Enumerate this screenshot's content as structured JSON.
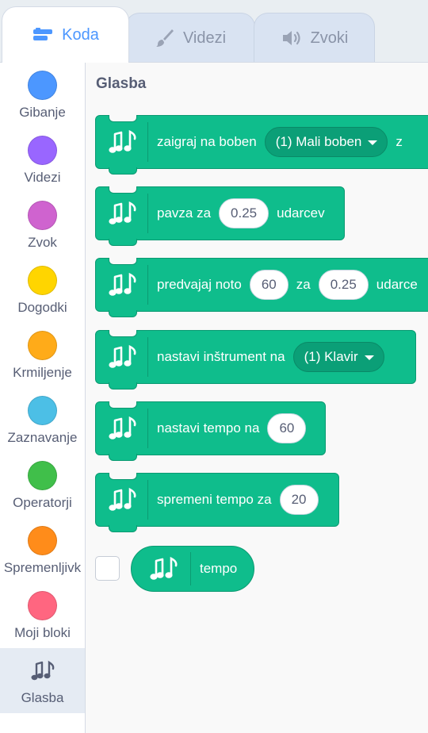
{
  "tabs": [
    {
      "label": "Koda",
      "icon": "code-icon",
      "active": true
    },
    {
      "label": "Videzi",
      "icon": "paintbrush-icon",
      "active": false
    },
    {
      "label": "Zvoki",
      "icon": "speaker-icon",
      "active": false
    }
  ],
  "categories": [
    {
      "label": "Gibanje",
      "color": "#4c97ff"
    },
    {
      "label": "Videzi",
      "color": "#9966ff"
    },
    {
      "label": "Zvok",
      "color": "#cf63cf"
    },
    {
      "label": "Dogodki",
      "color": "#ffd500"
    },
    {
      "label": "Krmiljenje",
      "color": "#ffab19"
    },
    {
      "label": "Zaznavanje",
      "color": "#4cbfe6"
    },
    {
      "label": "Operatorji",
      "color": "#40bf4a"
    },
    {
      "label": "Spremenljivk",
      "color": "#ff8c1a"
    },
    {
      "label": "Moji bloki",
      "color": "#ff6680"
    },
    {
      "label": "Glasba",
      "icon": "music-notes-icon",
      "selected": true
    }
  ],
  "palette": {
    "section_title": "Glasba",
    "blocks": {
      "drum": {
        "text": "zaigraj na boben",
        "dropdown": "(1) Mali boben",
        "trail": "z"
      },
      "rest": {
        "text": "pavza za",
        "value": "0.25",
        "suffix": "udarcev"
      },
      "note": {
        "text": "predvajaj noto",
        "value1": "60",
        "mid": "za",
        "value2": "0.25",
        "suffix": "udarce"
      },
      "instrument": {
        "text": "nastavi inštrument na",
        "dropdown": "(1) Klavir"
      },
      "set_tempo": {
        "text": "nastavi tempo na",
        "value": "60"
      },
      "change_tempo": {
        "text": "spremeni tempo za",
        "value": "20"
      },
      "tempo_reporter": {
        "label": "tempo",
        "checked": false
      }
    }
  },
  "colors": {
    "music_block": "#0fbd8c",
    "accent": "#4c97ff"
  }
}
